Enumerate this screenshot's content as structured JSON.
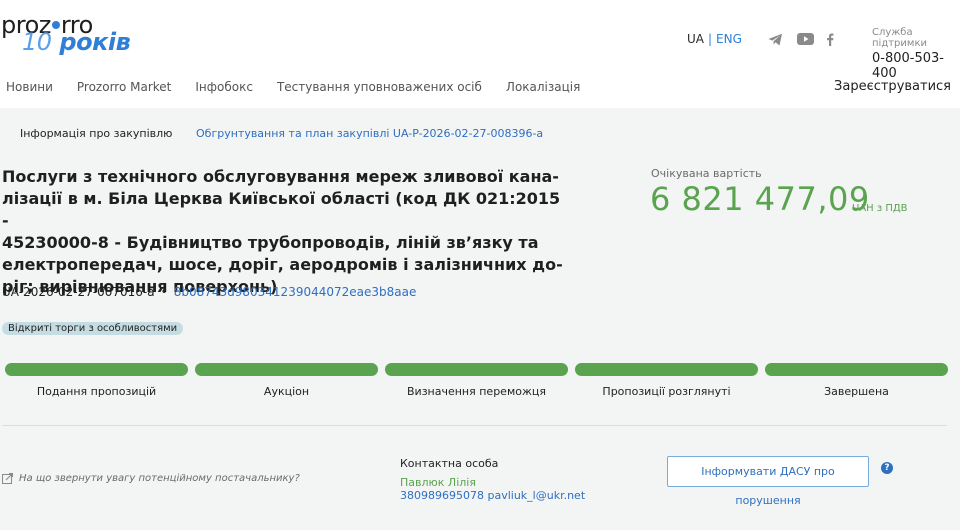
{
  "logo": {
    "main_left": "proz",
    "main_right": "rro",
    "sub_number": "10",
    "sub_word": "років"
  },
  "lang": {
    "ua": "UA",
    "separator": "|",
    "eng": "ENG"
  },
  "social_icons": [
    "telegram-icon",
    "youtube-icon",
    "facebook-icon"
  ],
  "support": {
    "label": "Служба підтримки",
    "phone": "0-800-503-400"
  },
  "nav": {
    "items": [
      "Новини",
      "Prozorro Market",
      "Інфобокс",
      "Тестування уповноважених осіб",
      "Локалізація"
    ],
    "register": "Зареєструватися"
  },
  "tabs": {
    "info": "Інформація про закупівлю",
    "plan": "Обгрунтування та план закупівлі UA-P-2026-02-27-008396-a"
  },
  "tender": {
    "title_lines": [
      "Послуги з технічного обслуговування мереж зливової кана-",
      "лізації в м. Біла Церква Київської області (код ДК 021:2015 -",
      "45230000-8 - Будівництво трубопроводів, ліній зв’язку та",
      "електропередач, шосе, доріг, аеродромів і залізничних до-",
      "ріг; вирівнювання поверхонь)"
    ],
    "expected_label": "Очікувана вартість",
    "amount": "6 821 477,09",
    "currency": "UAH з ПДВ",
    "id": "UA-2026-02-27-007016-a",
    "bullet": "•",
    "hash": "8b08743d980341239044072eae3b8aae",
    "procedure": "Відкриті торги з особливостями"
  },
  "stages": [
    {
      "label": "Подання пропозицій",
      "status": "done"
    },
    {
      "label": "Аукціон",
      "status": "done"
    },
    {
      "label": "Визначення переможця",
      "status": "done"
    },
    {
      "label": "Пропозиції розглянуті",
      "status": "done"
    },
    {
      "label": "Завершена",
      "status": "done"
    }
  ],
  "footer": {
    "report_text": "На що звернути увагу потенційному постачальнику?",
    "contact_label": "Контактна особа",
    "contact_name": "Павлюк Лілія",
    "contact_info": "380989695078 pavliuk_l@ukr.net",
    "dasu_button": "Інформувати ДАСУ про порушення",
    "help_glyph": "?"
  },
  "colors": {
    "brand_blue": "#2f7fd6",
    "link_blue": "#2f6fc0",
    "stage_green": "#5aa34f",
    "badge_bg": "#c5dde2",
    "page_bg": "#f3f4f4"
  }
}
